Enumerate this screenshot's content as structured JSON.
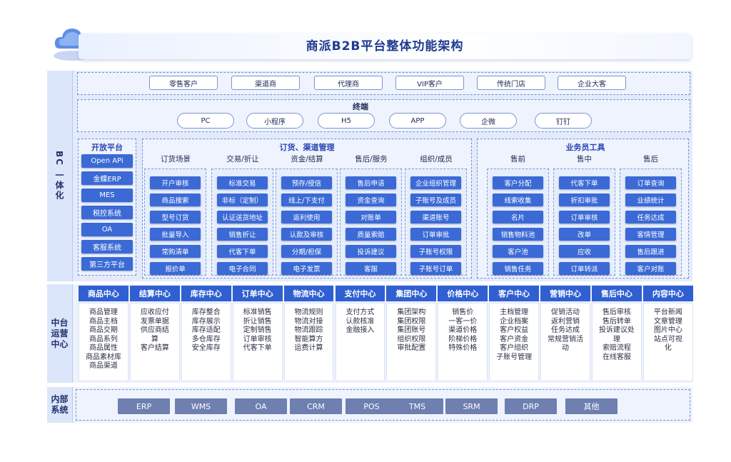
{
  "title": "商派B2B平台整体功能架构",
  "sections": {
    "bc": "BC 一体化",
    "middle": "中台\n运营\n中心",
    "internal": "内部\n系统"
  },
  "customers": [
    "零售客户",
    "渠道商",
    "代理商",
    "VIP客户",
    "传统门店",
    "企业大客"
  ],
  "terminal": {
    "title": "终端",
    "items": [
      "PC",
      "小程序",
      "H5",
      "APP",
      "企微",
      "钉钉"
    ]
  },
  "open_platform": {
    "title": "开放平台",
    "items": [
      "Open APi",
      "金蝶ERP",
      "MES",
      "税控系统",
      "OA",
      "客服系统",
      "第三方平台"
    ]
  },
  "order_channel": {
    "title": "订货、渠道管理",
    "columns": [
      {
        "title": "订货场景",
        "items": [
          "开户审核",
          "商品搜索",
          "型号订货",
          "批量导入",
          "常购清单",
          "报价单"
        ]
      },
      {
        "title": "交易/折让",
        "items": [
          "标准交易",
          "非标（定制）",
          "认证送货地址",
          "销售折让",
          "代客下单",
          "电子合同"
        ]
      },
      {
        "title": "资金/结算",
        "items": [
          "预存/授信",
          "线上/下支付",
          "返利使用",
          "认款及审核",
          "分期/担保",
          "电子发票"
        ]
      },
      {
        "title": "售后/服务",
        "items": [
          "售后申请",
          "资金查询",
          "对账单",
          "质量索赔",
          "投诉建议",
          "客服"
        ]
      },
      {
        "title": "组织/成员",
        "items": [
          "企业组织管理",
          "子账号及成员",
          "渠道账号",
          "订单审批",
          "子账号权限",
          "子账号订单"
        ]
      }
    ]
  },
  "sales_tools": {
    "title": "业务员工具",
    "columns": [
      {
        "title": "售前",
        "items": [
          "客户分配",
          "线索收集",
          "名片",
          "销售物料池",
          "客户池",
          "销售任务"
        ]
      },
      {
        "title": "售中",
        "items": [
          "代客下单",
          "折扣审批",
          "订单审核",
          "改单",
          "应收",
          "订单转派"
        ]
      },
      {
        "title": "售后",
        "items": [
          "订单查询",
          "业绩统计",
          "任务达成",
          "客情管理",
          "售后跟进",
          "客户对账"
        ]
      }
    ]
  },
  "middle_centers": [
    {
      "name": "商品中心",
      "desc": "商品管理\n商品主档\n商品交期\n商品系列\n商品属性\n商品素材库\n商品渠道"
    },
    {
      "name": "结算中心",
      "desc": "应收应付\n发票单据\n供应商结\n算\n客户结算"
    },
    {
      "name": "库存中心",
      "desc": "库存整合\n库存展示\n库存适配\n多仓库存\n安全库存"
    },
    {
      "name": "订单中心",
      "desc": "标准销售\n折让销售\n定制销售\n订单审核\n代客下单"
    },
    {
      "name": "物流中心",
      "desc": "物流规则\n物流对接\n物流跟踪\n智能算方\n运费计算"
    },
    {
      "name": "支付中心",
      "desc": "支付方式\n认款核准\n金融接入"
    },
    {
      "name": "集团中心",
      "desc": "集团架构\n集团权限\n集团账号\n组织权限\n审批配置"
    },
    {
      "name": "价格中心",
      "desc": "销售价\n一客一价\n渠道价格\n阶梯价格\n特殊价格"
    },
    {
      "name": "客户中心",
      "desc": "主档管理\n企业档案\n客户权益\n客户资金\n客户组织\n子账号管理"
    },
    {
      "name": "营销中心",
      "desc": "促销活动\n返利营销\n任务达成\n常规营销活\n动"
    },
    {
      "name": "售后中心",
      "desc": "售后审核\n售后转单\n投诉建议处\n理\n索赔流程\n在线客服"
    },
    {
      "name": "内容中心",
      "desc": "平台新闻\n文章管理\n图片中心\n站点可视\n化"
    }
  ],
  "internal_systems": [
    "ERP",
    "WMS",
    "OA",
    "CRM",
    "POS",
    "TMS",
    "SRM",
    "DRP",
    "其他"
  ],
  "colors": {
    "accent": "#2f5fd0",
    "button": "#3b6ad6",
    "system": "#6e7fb0"
  }
}
